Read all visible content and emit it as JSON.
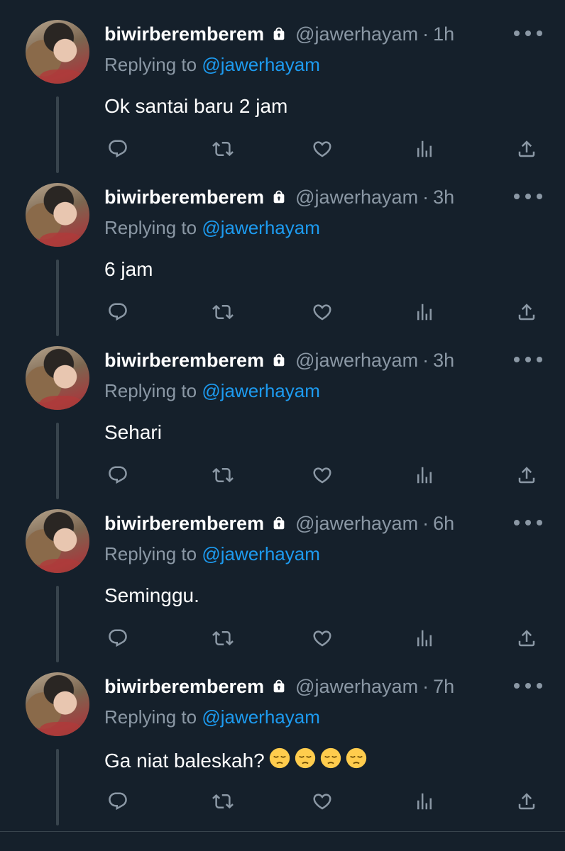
{
  "colors": {
    "background": "#15202b",
    "muted": "#8b98a5",
    "accent": "#1d9bf0",
    "text": "#ffffff"
  },
  "icons": [
    "lock-icon",
    "more-icon",
    "reply-icon",
    "retweet-icon",
    "like-icon",
    "views-icon",
    "share-icon",
    "pensive-face-emoji"
  ],
  "tweets": [
    {
      "name": "biwirberemberem",
      "handle": "@jawerhayam",
      "time": "1h",
      "reply_prefix": "Replying to",
      "reply_mention": "@jawerhayam",
      "text": "Ok santai baru 2 jam"
    },
    {
      "name": "biwirberemberem",
      "handle": "@jawerhayam",
      "time": "3h",
      "reply_prefix": "Replying to",
      "reply_mention": "@jawerhayam",
      "text": "6 jam"
    },
    {
      "name": "biwirberemberem",
      "handle": "@jawerhayam",
      "time": "3h",
      "reply_prefix": "Replying to",
      "reply_mention": "@jawerhayam",
      "text": "Sehari"
    },
    {
      "name": "biwirberemberem",
      "handle": "@jawerhayam",
      "time": "6h",
      "reply_prefix": "Replying to",
      "reply_mention": "@jawerhayam",
      "text": "Seminggu."
    },
    {
      "name": "biwirberemberem",
      "handle": "@jawerhayam",
      "time": "7h",
      "reply_prefix": "Replying to",
      "reply_mention": "@jawerhayam",
      "text": "Ga niat baleskah?",
      "emoji_count": 4
    }
  ]
}
